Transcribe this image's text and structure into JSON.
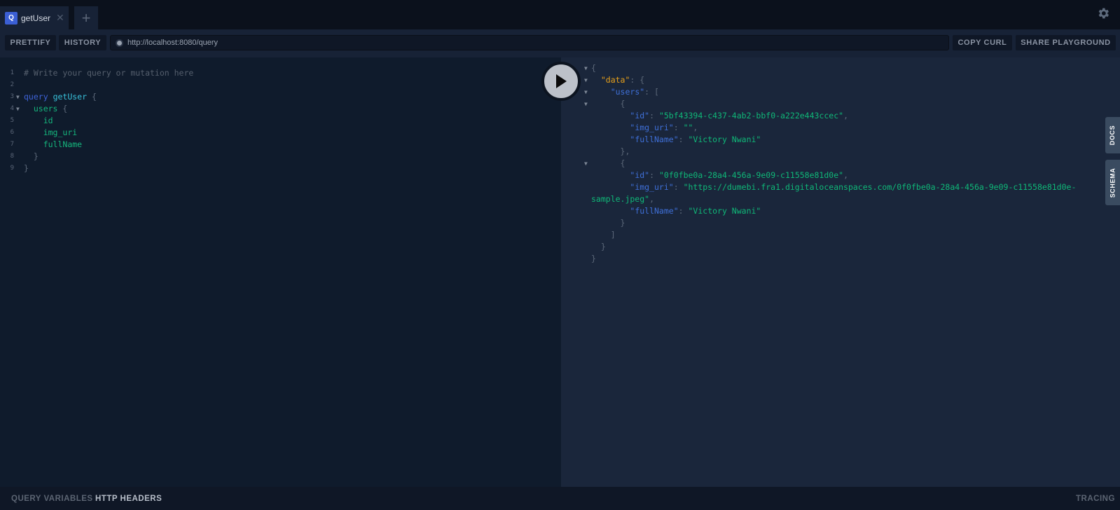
{
  "tabs": [
    {
      "label": "getUser",
      "icon": "Q"
    }
  ],
  "toolbar": {
    "prettify": "PRETTIFY",
    "history": "HISTORY",
    "endpoint": "http://localhost:8080/query",
    "copy_curl": "COPY CURL",
    "share": "SHARE PLAYGROUND"
  },
  "editor": {
    "lines": [
      {
        "n": "1",
        "segments": [
          {
            "t": "# Write your query or mutation here",
            "c": "c-comment"
          }
        ]
      },
      {
        "n": "2",
        "segments": []
      },
      {
        "n": "3",
        "fold": true,
        "segments": [
          {
            "t": "query",
            "c": "c-kw"
          },
          {
            "t": " ",
            "c": ""
          },
          {
            "t": "getUser",
            "c": "c-def"
          },
          {
            "t": " {",
            "c": "c-punc"
          }
        ]
      },
      {
        "n": "4",
        "fold": true,
        "segments": [
          {
            "t": "  ",
            "c": ""
          },
          {
            "t": "users",
            "c": "c-field"
          },
          {
            "t": " {",
            "c": "c-punc"
          }
        ]
      },
      {
        "n": "5",
        "segments": [
          {
            "t": "    ",
            "c": ""
          },
          {
            "t": "id",
            "c": "c-field"
          }
        ]
      },
      {
        "n": "6",
        "segments": [
          {
            "t": "    ",
            "c": ""
          },
          {
            "t": "img_uri",
            "c": "c-field"
          }
        ]
      },
      {
        "n": "7",
        "segments": [
          {
            "t": "    ",
            "c": ""
          },
          {
            "t": "fullName",
            "c": "c-field"
          }
        ]
      },
      {
        "n": "8",
        "segments": [
          {
            "t": "  }",
            "c": "c-punc"
          }
        ]
      },
      {
        "n": "9",
        "segments": [
          {
            "t": "}",
            "c": "c-punc"
          }
        ]
      }
    ]
  },
  "result": {
    "lines": [
      {
        "fold": true,
        "segments": [
          {
            "t": "{",
            "c": "c-punc"
          }
        ]
      },
      {
        "fold": true,
        "segments": [
          {
            "t": "  ",
            "c": ""
          },
          {
            "t": "\"data\"",
            "c": "c-data"
          },
          {
            "t": ": {",
            "c": "c-punc"
          }
        ]
      },
      {
        "fold": true,
        "segments": [
          {
            "t": "    ",
            "c": ""
          },
          {
            "t": "\"users\"",
            "c": "c-key"
          },
          {
            "t": ": [",
            "c": "c-punc"
          }
        ]
      },
      {
        "fold": true,
        "segments": [
          {
            "t": "      {",
            "c": "c-punc"
          }
        ]
      },
      {
        "segments": [
          {
            "t": "        ",
            "c": ""
          },
          {
            "t": "\"id\"",
            "c": "c-key"
          },
          {
            "t": ": ",
            "c": "c-punc"
          },
          {
            "t": "\"5bf43394-c437-4ab2-bbf0-a222e443ccec\"",
            "c": "c-str"
          },
          {
            "t": ",",
            "c": "c-punc"
          }
        ]
      },
      {
        "segments": [
          {
            "t": "        ",
            "c": ""
          },
          {
            "t": "\"img_uri\"",
            "c": "c-key"
          },
          {
            "t": ": ",
            "c": "c-punc"
          },
          {
            "t": "\"\"",
            "c": "c-str"
          },
          {
            "t": ",",
            "c": "c-punc"
          }
        ]
      },
      {
        "segments": [
          {
            "t": "        ",
            "c": ""
          },
          {
            "t": "\"fullName\"",
            "c": "c-key"
          },
          {
            "t": ": ",
            "c": "c-punc"
          },
          {
            "t": "\"Victory Nwani\"",
            "c": "c-str"
          }
        ]
      },
      {
        "segments": [
          {
            "t": "      },",
            "c": "c-punc"
          }
        ]
      },
      {
        "fold": true,
        "segments": [
          {
            "t": "      {",
            "c": "c-punc"
          }
        ]
      },
      {
        "segments": [
          {
            "t": "        ",
            "c": ""
          },
          {
            "t": "\"id\"",
            "c": "c-key"
          },
          {
            "t": ": ",
            "c": "c-punc"
          },
          {
            "t": "\"0f0fbe0a-28a4-456a-9e09-c11558e81d0e\"",
            "c": "c-str"
          },
          {
            "t": ",",
            "c": "c-punc"
          }
        ]
      },
      {
        "segments": [
          {
            "t": "        ",
            "c": ""
          },
          {
            "t": "\"img_uri\"",
            "c": "c-key"
          },
          {
            "t": ": ",
            "c": "c-punc"
          },
          {
            "t": "\"https://dumebi.fra1.digitaloceanspaces.com/0f0fbe0a-28a4-456a-9e09-c11558e81d0e-",
            "c": "c-str"
          }
        ]
      },
      {
        "segments": [
          {
            "t": "sample.jpeg\"",
            "c": "c-str"
          },
          {
            "t": ",",
            "c": "c-punc"
          }
        ]
      },
      {
        "segments": [
          {
            "t": "        ",
            "c": ""
          },
          {
            "t": "\"fullName\"",
            "c": "c-key"
          },
          {
            "t": ": ",
            "c": "c-punc"
          },
          {
            "t": "\"Victory Nwani\"",
            "c": "c-str"
          }
        ]
      },
      {
        "segments": [
          {
            "t": "      }",
            "c": "c-punc"
          }
        ]
      },
      {
        "segments": [
          {
            "t": "    ]",
            "c": "c-punc"
          }
        ]
      },
      {
        "segments": [
          {
            "t": "  }",
            "c": "c-punc"
          }
        ]
      },
      {
        "segments": [
          {
            "t": "}",
            "c": "c-punc"
          }
        ]
      }
    ]
  },
  "side_tabs": {
    "docs": "DOCS",
    "schema": "SCHEMA"
  },
  "bottom": {
    "query_variables": "QUERY VARIABLES",
    "http_headers": "HTTP HEADERS",
    "tracing": "TRACING"
  }
}
